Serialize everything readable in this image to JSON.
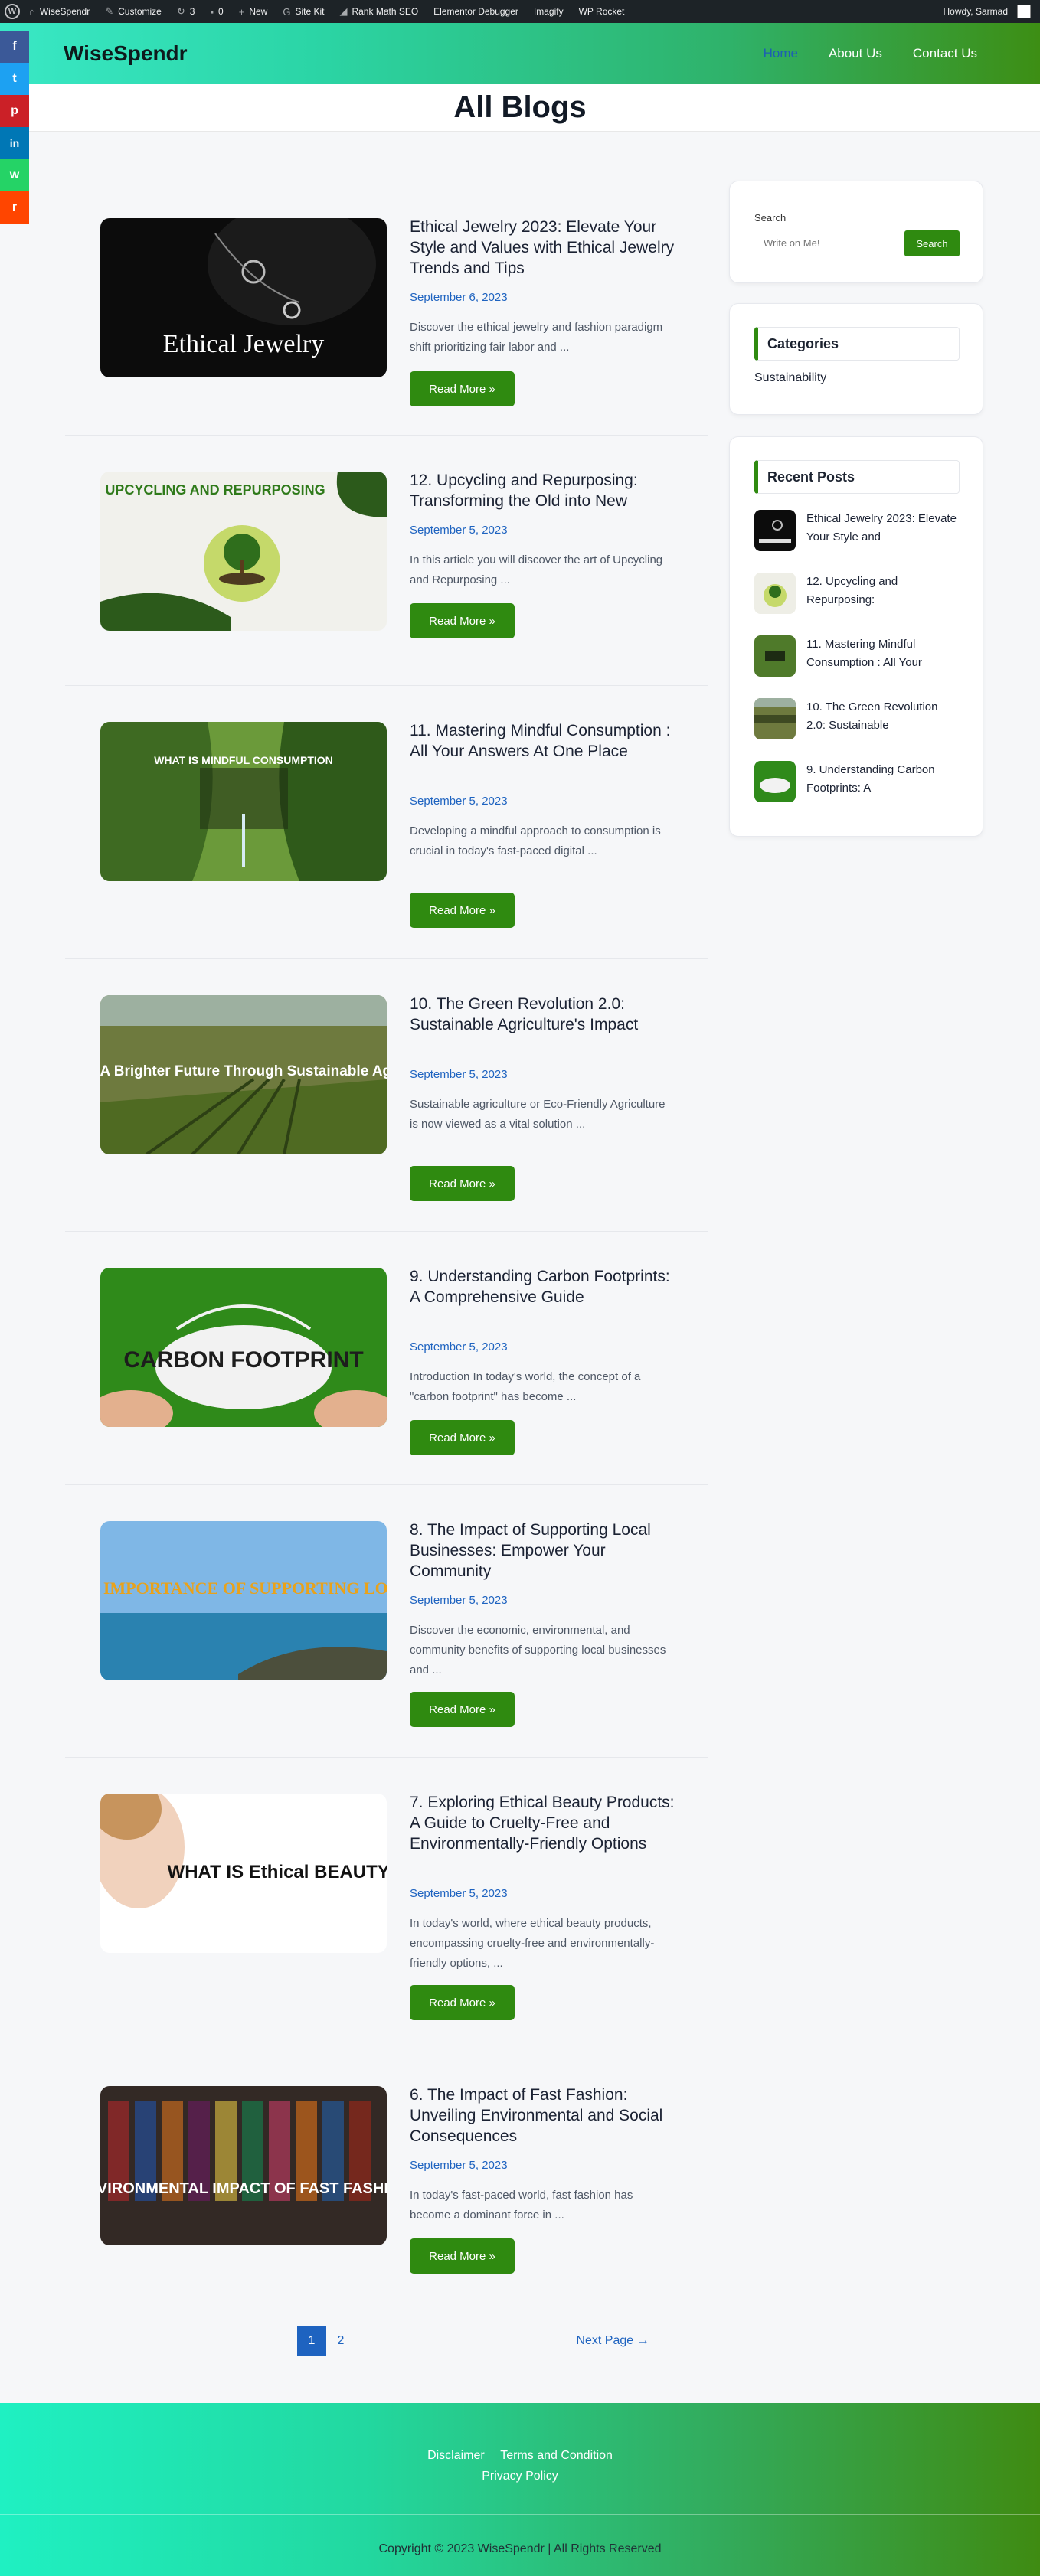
{
  "admin_bar": {
    "items": [
      "WiseSpendr",
      "Customize",
      "3",
      "0",
      "New",
      "Site Kit",
      "Rank Math SEO",
      "Elementor Debugger",
      "Imagify",
      "WP Rocket"
    ],
    "greeting": "Howdy, Sarmad"
  },
  "site": {
    "logo": "WiseSpendr",
    "nav": [
      "Home",
      "About Us",
      "Contact Us"
    ]
  },
  "page_title": "All Blogs",
  "share": [
    "f",
    "t",
    "p",
    "in",
    "w",
    "r"
  ],
  "posts": [
    {
      "title": "Ethical Jewelry 2023: Elevate Your Style and Values with Ethical Jewelry Trends and Tips",
      "date": "September 6, 2023",
      "excerpt": "Discover the ethical jewelry and fashion paradigm shift prioritizing fair labor and ...",
      "read_more": "Read More »",
      "thumb_text": "Ethical Jewelry"
    },
    {
      "title": "12. Upcycling and Repurposing: Transforming the Old into New",
      "date": "September 5, 2023",
      "excerpt": "In this article you will discover the art of Upcycling and Repurposing ...",
      "read_more": "Read More »",
      "thumb_text": "UPCYCLING AND REPURPOSING"
    },
    {
      "title": "11. Mastering Mindful Consumption : All Your Answers At One Place",
      "date": "September 5, 2023",
      "excerpt": "Developing a mindful approach to consumption is crucial in today's fast-paced digital ...",
      "read_more": "Read More »",
      "thumb_text": "WHAT IS MINDFUL CONSUMPTION"
    },
    {
      "title": "10. The Green Revolution 2.0: Sustainable Agriculture's Impact",
      "date": "September 5, 2023",
      "excerpt": "Sustainable agriculture or Eco-Friendly Agriculture is now viewed as a vital solution ...",
      "read_more": "Read More »",
      "thumb_text": "Growing A Brighter Future Through Sustainable Agriculture"
    },
    {
      "title": "9. Understanding Carbon Footprints: A Comprehensive Guide",
      "date": "September 5, 2023",
      "excerpt": "Introduction In today's world, the concept of a \"carbon footprint\" has become ...",
      "read_more": "Read More »",
      "thumb_text": "CARBON FOOTPRINT"
    },
    {
      "title": "8. The Impact of Supporting Local Businesses: Empower Your Community",
      "date": "September 5, 2023",
      "excerpt": "Discover the economic, environmental, and community benefits of supporting local businesses and ...",
      "read_more": "Read More »",
      "thumb_text": "THE IMPORTANCE OF SUPPORTING LOCAL"
    },
    {
      "title": "7. Exploring Ethical Beauty Products: A Guide to Cruelty-Free and Environmentally-Friendly Options",
      "date": "September 5, 2023",
      "excerpt": "In today's world, where ethical beauty products, encompassing cruelty-free and environmentally-friendly options, ...",
      "read_more": "Read More »",
      "thumb_text": "WHAT IS Ethical BEAUTY?"
    },
    {
      "title": "6. The Impact of Fast Fashion: Unveiling Environmental and Social Consequences",
      "date": "September 5, 2023",
      "excerpt": "In today's fast-paced world, fast fashion has become a dominant force in ...",
      "read_more": "Read More »",
      "thumb_text": "ENVIRONMENTAL IMPACT OF FAST FASHION"
    }
  ],
  "pagination": {
    "pages": [
      "1",
      "2"
    ],
    "current": "1",
    "next": "Next Page →"
  },
  "sidebar": {
    "search": {
      "label": "Search",
      "placeholder": "Write on Me!",
      "button": "Search"
    },
    "categories": {
      "title": "Categories",
      "items": [
        "Sustainability"
      ]
    },
    "recent": {
      "title": "Recent Posts",
      "items": [
        "Ethical Jewelry 2023: Elevate Your Style and",
        "12. Upcycling and Repurposing:",
        "11. Mastering Mindful Consumption : All Your",
        "10. The Green Revolution 2.0: Sustainable",
        "9. Understanding Carbon Footprints: A"
      ]
    }
  },
  "footer": {
    "links": [
      "Disclaimer",
      "Terms and Condition",
      "Privacy Policy"
    ],
    "copyright": "Copyright © 2023 WiseSpendr | All Rights Reserved"
  },
  "colors": {
    "accent": "#2f8a10",
    "link": "#1e63c0",
    "header_start": "#39e8c5",
    "header_end": "#3d8e14"
  }
}
